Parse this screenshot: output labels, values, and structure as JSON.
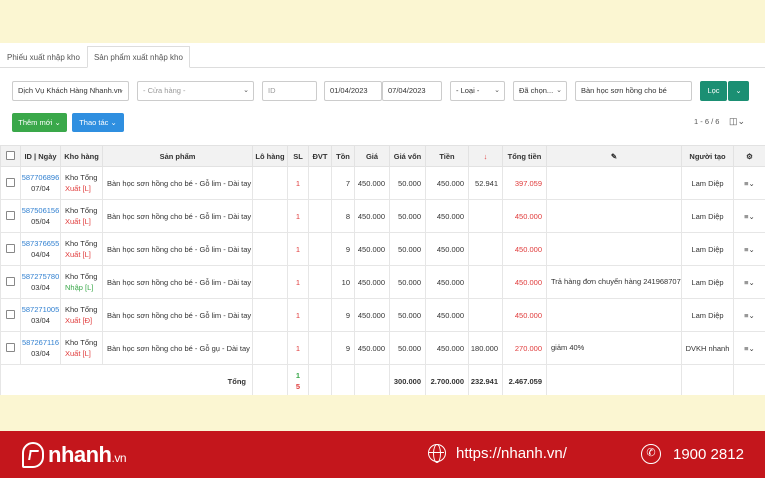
{
  "tabs": [
    "Phiếu xuất nhập kho",
    "Sản phẩm xuất nhập kho"
  ],
  "filters": {
    "service": "Dịch Vụ Khách Hàng Nhanh.vn",
    "store_placeholder": "- Cửa hàng -",
    "id_placeholder": "ID",
    "date_from": "01/04/2023",
    "date_to": "07/04/2023",
    "type": "- Loại -",
    "selected": "Đã chọn...",
    "product_search": "Bàn học sơn hồng cho bé",
    "filter_button": "Lọc"
  },
  "actions": {
    "add_new": "Thêm mới",
    "actions": "Thao tác"
  },
  "pagination": "1 - 6 / 6",
  "columns": [
    "ID | Ngày",
    "Kho hàng",
    "Sản phẩm",
    "Lô hàng",
    "SL",
    "ĐVT",
    "Tồn",
    "Giá",
    "Giá vốn",
    "Tiền",
    "↓",
    "Tổng tiền",
    "",
    "Người tạo",
    ""
  ],
  "rows": [
    {
      "id": "587706896",
      "date": "07/04",
      "kho": "Kho Tổng",
      "type": "Xuất [L]",
      "product": "Bàn học sơn hồng cho bé - Gỗ lim - Dài tay",
      "sl": "1",
      "ton": "7",
      "gia": "450.000",
      "giavon": "50.000",
      "tien": "450.000",
      "discount": "52.941",
      "tong": "397.059",
      "note": "",
      "nguoitao": "Lam Diệp"
    },
    {
      "id": "587506156",
      "date": "05/04",
      "kho": "Kho Tổng",
      "type": "Xuất [L]",
      "product": "Bàn học sơn hồng cho bé - Gỗ lim - Dài tay",
      "sl": "1",
      "ton": "8",
      "gia": "450.000",
      "giavon": "50.000",
      "tien": "450.000",
      "discount": "",
      "tong": "450.000",
      "note": "",
      "nguoitao": "Lam Diệp"
    },
    {
      "id": "587376655",
      "date": "04/04",
      "kho": "Kho Tổng",
      "type": "Xuất [L]",
      "product": "Bàn học sơn hồng cho bé - Gỗ lim - Dài tay",
      "sl": "1",
      "ton": "9",
      "gia": "450.000",
      "giavon": "50.000",
      "tien": "450.000",
      "discount": "",
      "tong": "450.000",
      "note": "",
      "nguoitao": "Lam Diệp"
    },
    {
      "id": "587275780",
      "date": "03/04",
      "kho": "Kho Tổng",
      "type": "Nhập [L]",
      "product": "Bàn học sơn hồng cho bé - Gỗ lim - Dài tay",
      "sl": "1",
      "ton": "10",
      "gia": "450.000",
      "giavon": "50.000",
      "tien": "450.000",
      "discount": "",
      "tong": "450.000",
      "note": "Trả hàng đơn chuyển hàng 241968707",
      "nguoitao": "Lam Diệp"
    },
    {
      "id": "587271005",
      "date": "03/04",
      "kho": "Kho Tổng",
      "type": "Xuất [Đ]",
      "product": "Bàn học sơn hồng cho bé - Gỗ lim - Dài tay",
      "sl": "1",
      "ton": "9",
      "gia": "450.000",
      "giavon": "50.000",
      "tien": "450.000",
      "discount": "",
      "tong": "450.000",
      "note": "",
      "nguoitao": "Lam Diệp"
    },
    {
      "id": "587267116",
      "date": "03/04",
      "kho": "Kho Tổng",
      "type": "Xuất [L]",
      "product": "Bàn học sơn hồng cho bé - Gỗ gụ - Dài tay",
      "sl": "1",
      "ton": "9",
      "gia": "450.000",
      "giavon": "50.000",
      "tien": "450.000",
      "discount": "180.000",
      "tong": "270.000",
      "note": "giảm 40%",
      "nguoitao": "DVKH nhanh"
    }
  ],
  "totals": {
    "label": "Tổng",
    "sl_in": "1",
    "sl_out": "5",
    "giavon": "300.000",
    "tien": "2.700.000",
    "discount": "232.941",
    "tong": "2.467.059"
  },
  "footer": {
    "brand": "nhanh",
    "brand_suffix": ".vn",
    "website": "https://nhanh.vn/",
    "hotline": "1900 2812"
  },
  "colors": {
    "accent_green": "#3aa84a",
    "accent_blue": "#2f8fe0",
    "brand_red": "#c4161c",
    "value_red": "#e03b3b"
  }
}
